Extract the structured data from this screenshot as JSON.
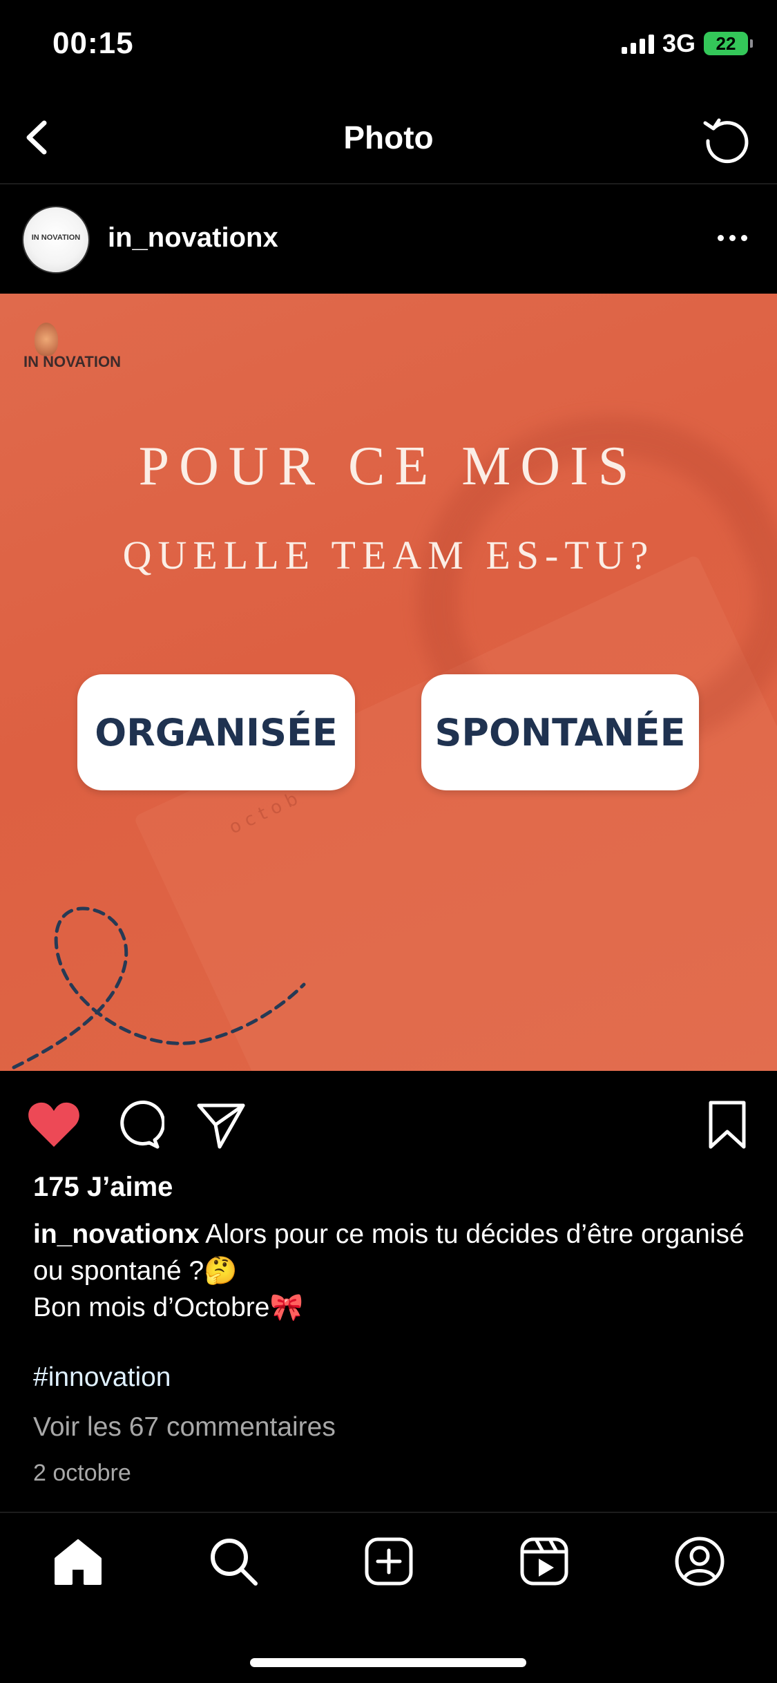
{
  "status_bar": {
    "time": "00:15",
    "network": "3G",
    "battery": "22"
  },
  "header": {
    "title": "Photo"
  },
  "post": {
    "username": "in_novationx",
    "avatar_text": "IN NOVATION",
    "image": {
      "logo_text": "IN NOVATION",
      "headline1": "POUR CE MOIS",
      "headline2": "QUELLE TEAM ES-TU?",
      "option_left": "ORGANISÉE",
      "option_right": "SPONTANÉE",
      "accent_color": "#dd6042",
      "button_text_color": "#1f3250"
    },
    "likes": "175 J’aime",
    "caption_user": "in_novationx",
    "caption_text": " Alors pour ce mois tu décides d’être organisé ou spontané ?🤔",
    "caption_line2": "Bon mois d’Octobre🎀",
    "hashtag": "#innovation",
    "comments_link": "Voir les 67 commentaires",
    "date": "2 octobre",
    "liked": true,
    "like_color": "#ed4956"
  },
  "tabbar": {
    "items": [
      "home-icon",
      "search-icon",
      "add-post-icon",
      "reels-icon",
      "profile-icon"
    ]
  }
}
